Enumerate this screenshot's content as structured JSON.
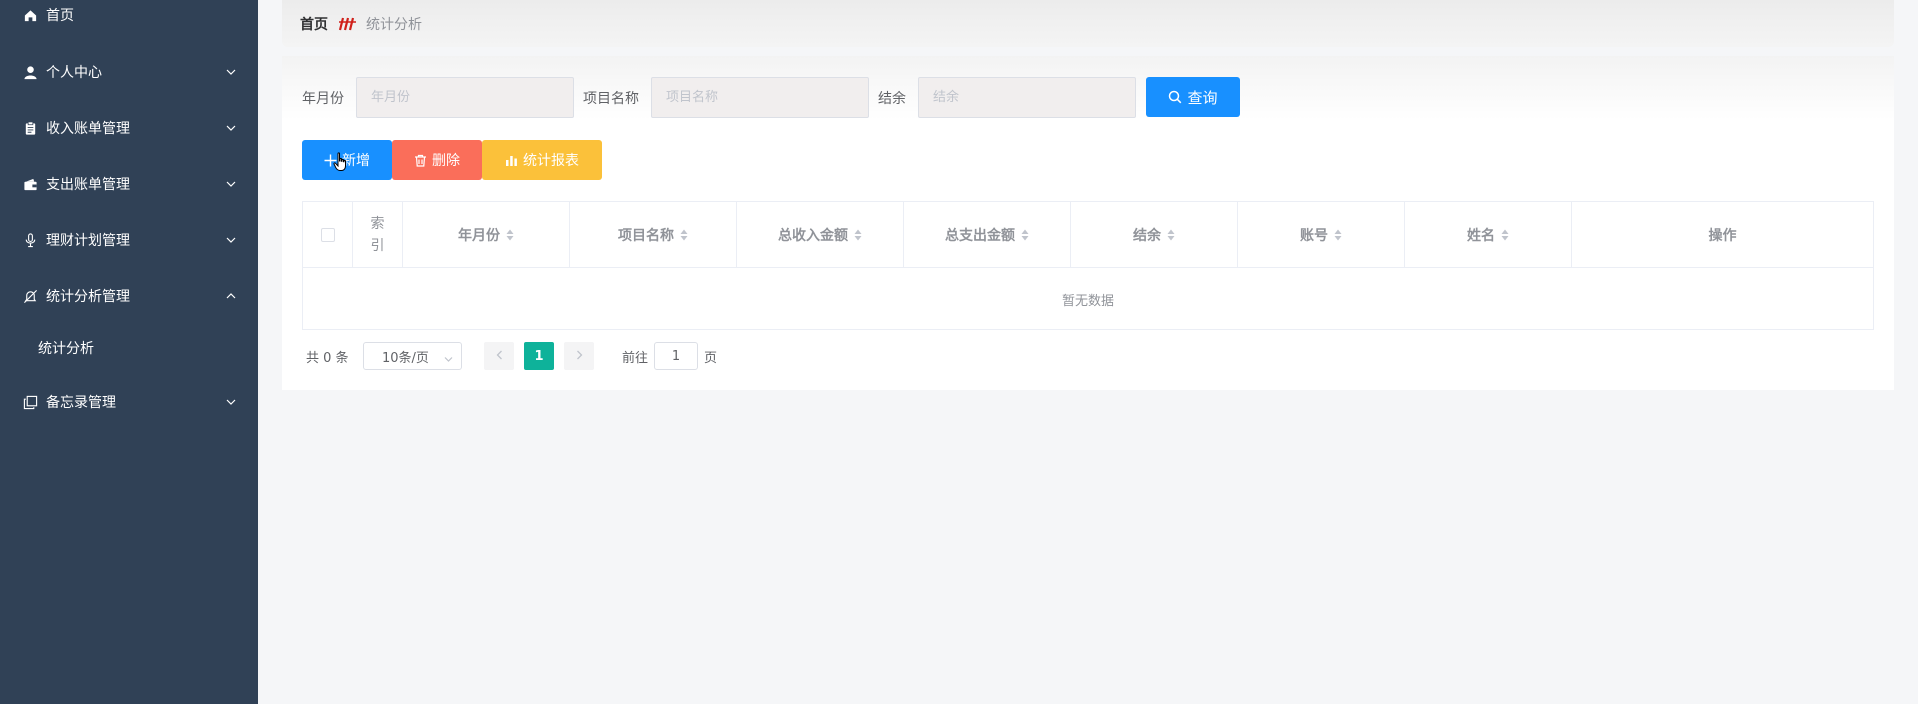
{
  "colors": {
    "sidebar_bg": "#304156",
    "primary": "#1890ff",
    "danger": "#fa6e5a",
    "warning": "#fbc13a",
    "success": "#0eb29a"
  },
  "sidebar": {
    "items": [
      {
        "label": "首页",
        "icon": "home-icon"
      },
      {
        "label": "个人中心",
        "icon": "user-icon"
      },
      {
        "label": "收入账单管理",
        "icon": "clipboard-icon"
      },
      {
        "label": "支出账单管理",
        "icon": "wallet-icon"
      },
      {
        "label": "理财计划管理",
        "icon": "microphone-icon"
      },
      {
        "label": "统计分析管理",
        "icon": "bell-off-icon"
      },
      {
        "label": "备忘录管理",
        "icon": "copy-icon"
      }
    ],
    "submenu": {
      "label": "统计分析"
    }
  },
  "breadcrumb": {
    "home": "首页",
    "current": "统计分析"
  },
  "search": {
    "year_month_label": "年月份",
    "year_month_placeholder": "年月份",
    "project_label": "项目名称",
    "project_placeholder": "项目名称",
    "balance_label": "结余",
    "balance_placeholder": "结余",
    "query_button": "查询"
  },
  "toolbar": {
    "add_label": "新增",
    "delete_label": "删除",
    "report_label": "统计报表"
  },
  "table": {
    "index_col": "索引",
    "columns": [
      "年月份",
      "项目名称",
      "总收入金额",
      "总支出金额",
      "结余",
      "账号",
      "姓名"
    ],
    "action_col": "操作",
    "empty_text": "暂无数据"
  },
  "pagination": {
    "total": "共 0 条",
    "page_size": "10条/页",
    "current_page": "1",
    "goto_label": "前往",
    "goto_value": "1",
    "goto_suffix": "页"
  }
}
